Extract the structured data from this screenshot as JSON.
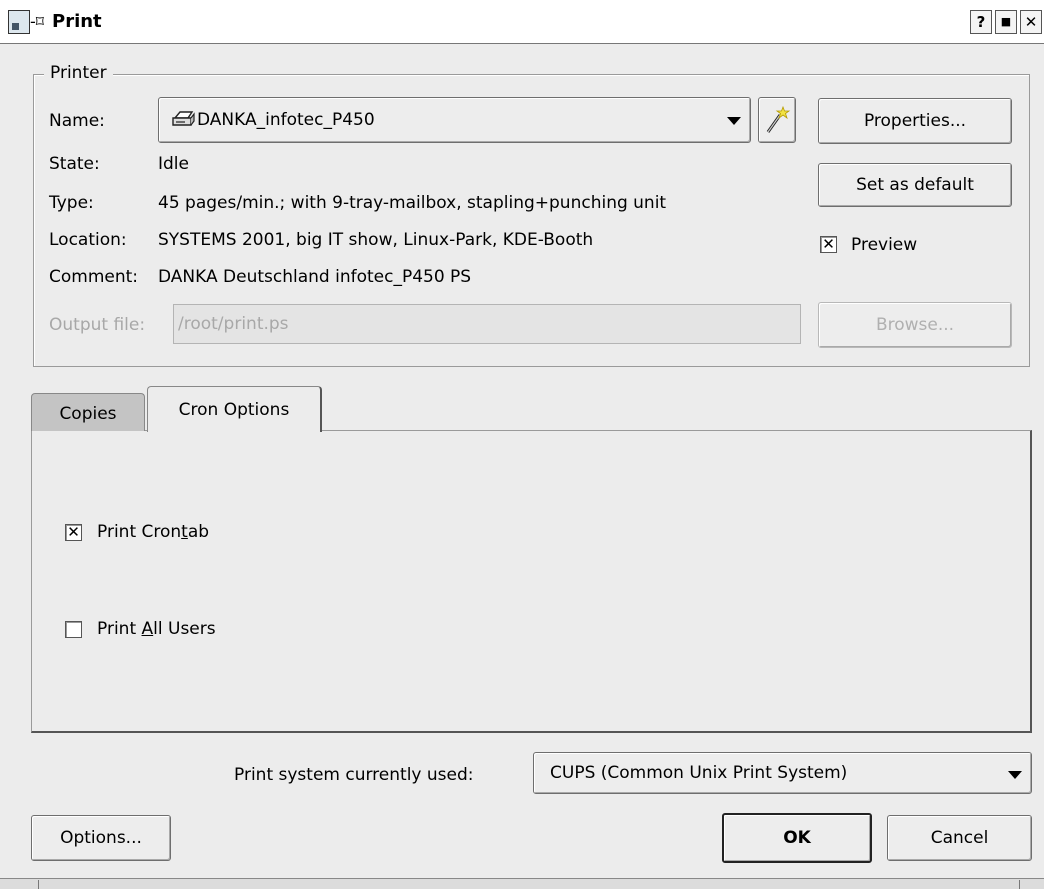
{
  "window": {
    "title": "Print",
    "sticky_glyph": "-⌑",
    "controls": {
      "help": "?",
      "maximize": "■",
      "close": "✕"
    },
    "icon": "print-app-icon"
  },
  "printer_group": {
    "legend": "Printer",
    "name_label": "Name:",
    "name_value": "DANKA_infotec_P450",
    "printer_icon": "printer-icon",
    "wizard_icon": "magic-wand-icon",
    "state_label": "State:",
    "state_value": "Idle",
    "type_label": "Type:",
    "type_value": "45 pages/min.; with 9-tray-mailbox, stapling+punching unit",
    "location_label": "Location:",
    "location_value": "SYSTEMS 2001, big IT show, Linux-Park, KDE-Booth",
    "comment_label": "Comment:",
    "comment_value": "DANKA Deutschland infotec_P450 PS",
    "output_file_label": "Output file:",
    "output_file_value": "/root/print.ps",
    "properties_button": "Properties...",
    "set_default_button": "Set as default",
    "preview_label": "Preview",
    "preview_checked": true,
    "browse_button": "Browse..."
  },
  "tabs": [
    {
      "label": "Copies",
      "active": false
    },
    {
      "label": "Cron Options",
      "active": true
    }
  ],
  "cron_options": {
    "print_crontab_pre": "Print Cron",
    "print_crontab_accel": "t",
    "print_crontab_post": "ab",
    "print_crontab_checked": true,
    "print_all_users_pre": "Print ",
    "print_all_users_accel": "A",
    "print_all_users_post": "ll Users",
    "print_all_users_checked": false
  },
  "print_system": {
    "label": "Print system currently used:",
    "value": "CUPS (Common Unix Print System)"
  },
  "footer": {
    "options_button": "Options...",
    "ok_button": "OK",
    "cancel_button": "Cancel"
  },
  "colors": {
    "background": "#ececec",
    "inactive_tab": "#c4c4c4",
    "disabled_text": "#a8a8a8"
  }
}
